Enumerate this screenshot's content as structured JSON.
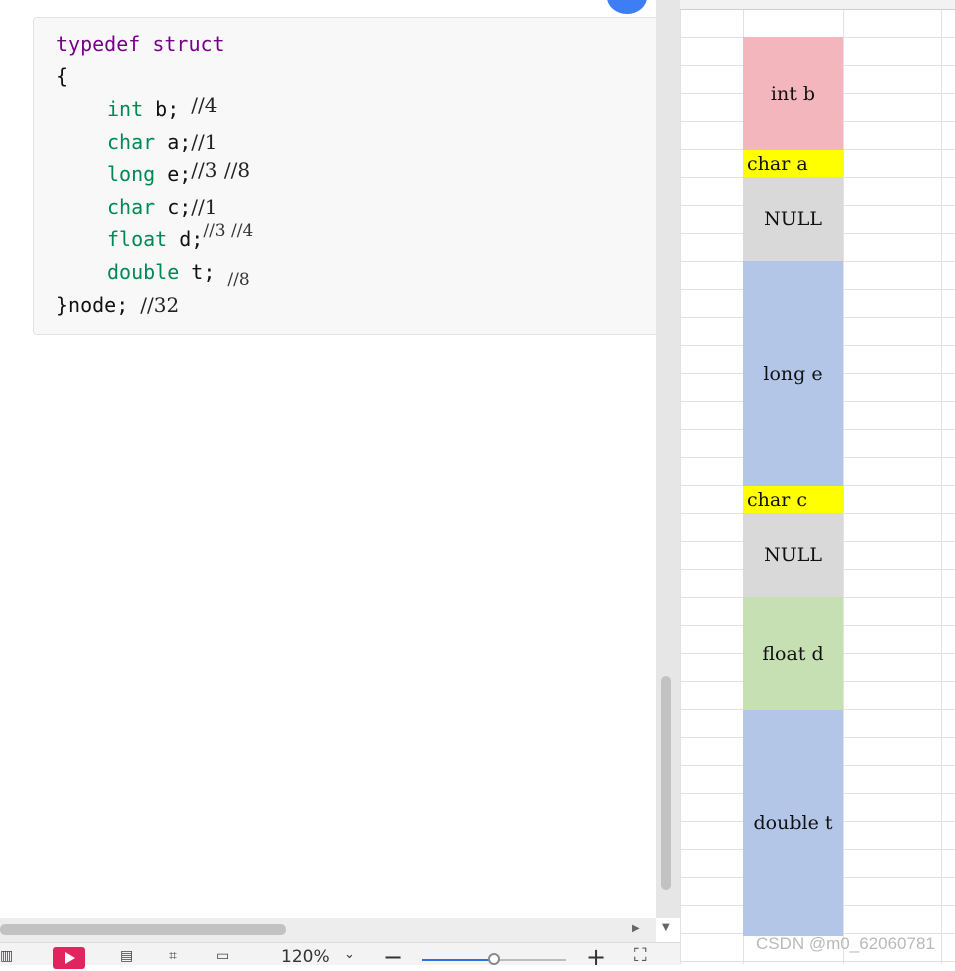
{
  "code_block": {
    "line1_kw1": "typedef",
    "line1_kw2": "struct",
    "line2": "{",
    "line3_type": "int",
    "line3_rest": " b;",
    "line3_note": "//4",
    "line4_type": "char",
    "line4_rest": " a;",
    "line4_note": "//1",
    "line5_type": "long",
    "line5_rest": " e;",
    "line5_note": "//3 //8",
    "line6_type": "char",
    "line6_rest": " c;",
    "line6_note": "//1",
    "line7_type": "float",
    "line7_rest": " d;",
    "line7_note": "//3 //4",
    "line8_type": "double",
    "line8_rest": " t;",
    "line8_note": "//8",
    "line9": "}node;",
    "line9_note": "//32"
  },
  "statusbar": {
    "zoom_label": "120%",
    "zoom_level_percent": 50
  },
  "memory_layout": [
    {
      "label": "int b",
      "color": "#f4b6bd"
    },
    {
      "label": "char a",
      "color": "#ffff00"
    },
    {
      "label": "NULL",
      "color": "#d9d9d9"
    },
    {
      "label": "long e",
      "color": "#b4c6e7"
    },
    {
      "label": "char c",
      "color": "#ffff00"
    },
    {
      "label": "NULL",
      "color": "#d9d9d9"
    },
    {
      "label": "float d",
      "color": "#c6e0b4"
    },
    {
      "label": "double t",
      "color": "#b4c6e7"
    }
  ],
  "watermark": "CSDN @m0_62060781"
}
